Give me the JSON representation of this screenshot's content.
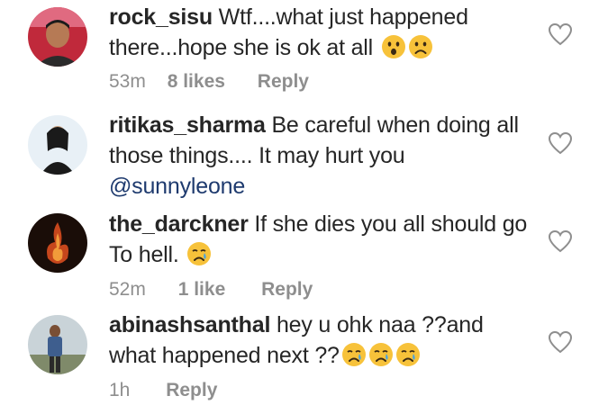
{
  "comments": [
    {
      "username": "rock_sisu",
      "text": " Wtf....what just happened there...hope she is ok at all ",
      "emojis": [
        "astonished-face",
        "frowning-face"
      ],
      "time": "53m",
      "likes": "8 likes",
      "reply": "Reply"
    },
    {
      "username": "ritikas_sharma",
      "text": " Be careful  when  doing all those  things.... It may hurt  you ",
      "mention": "@sunnyleone",
      "emojis": []
    },
    {
      "username": "the_darckner",
      "text": " If she dies you all should go To hell. ",
      "emojis": [
        "crying-face"
      ],
      "time": "52m",
      "likes": "1 like",
      "reply": "Reply"
    },
    {
      "username": "abinashsanthal",
      "text": " hey u ohk naa ??and what happened next ??",
      "emojis": [
        "crying-face",
        "crying-face",
        "crying-face"
      ],
      "time": "1h",
      "reply": "Reply"
    }
  ],
  "colors": {
    "text": "#262626",
    "meta": "#8e8e8e",
    "mention": "#1e3a6e",
    "emoji_yellow": "#f7c23a"
  }
}
